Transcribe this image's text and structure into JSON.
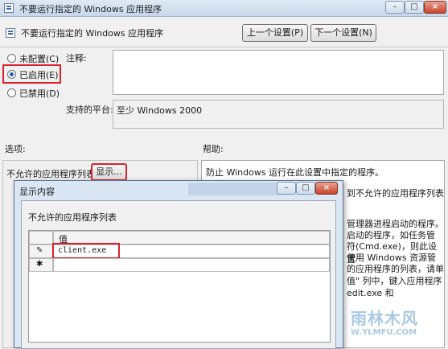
{
  "window": {
    "title": "不要运行指定的 Windows 应用程序",
    "controls": {
      "minimize": "–",
      "maximize": "□",
      "close": "×"
    }
  },
  "header": {
    "policy_name": "不要运行指定的 Windows 应用程序",
    "prev_button": "上一个设置(P)",
    "next_button": "下一个设置(N)"
  },
  "state": {
    "not_configured": "未配置(C)",
    "enabled": "已启用(E)",
    "disabled": "已禁用(D)",
    "selected": "enabled"
  },
  "comment": {
    "label": "注释:",
    "value": ""
  },
  "platform": {
    "label": "支持的平台:",
    "value": "至少 Windows 2000"
  },
  "options": {
    "label": "选项:",
    "list_label": "不允许的应用程序列表",
    "show_button": "显示..."
  },
  "help": {
    "label": "帮助:",
    "line1": "防止 Windows 运行在此设置中指定的程序。",
    "line2": "到不允许的应用程序列表",
    "line3": "管理器进程启动的程序。",
    "line4": "启动的程序，如任务管",
    "line5": "符(Cmd.exe)，则此设置",
    "line6": "使用 Windows 资源管",
    "line7": "的应用程序的列表，请单",
    "line8": "值\" 列中，键入应用程序",
    "line9": "edit.exe 和"
  },
  "dialog": {
    "title": "显示内容",
    "list_label": "不允许的应用程序列表",
    "column_header": "值",
    "rows": [
      "client.exe"
    ],
    "edit_glyph": "✎",
    "new_row_glyph": "✱"
  },
  "watermark": {
    "brand": "雨林木风",
    "url": "W.YLMFU.COM"
  },
  "colors": {
    "highlight": "#d9232e",
    "selection_radio": "#1e5fb4"
  }
}
